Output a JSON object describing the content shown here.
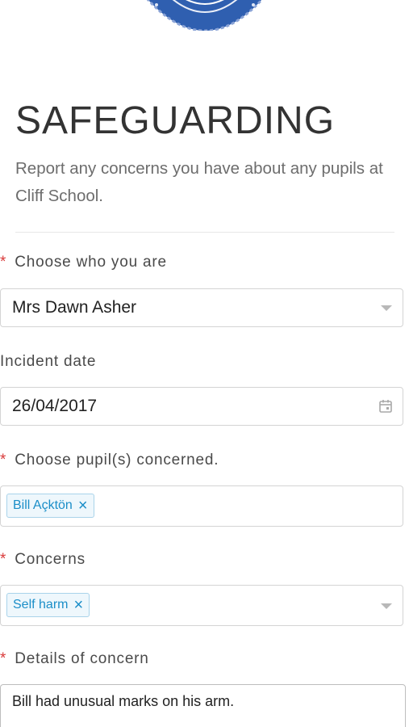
{
  "header": {
    "title": "SAFEGUARDING",
    "subtitle": "Report any concerns you have about any pupils at Cliff School."
  },
  "form": {
    "required_marker": "*",
    "who": {
      "label": "Choose who you are",
      "value": "Mrs Dawn Asher"
    },
    "incident_date": {
      "label": "Incident date",
      "value": "26/04/2017"
    },
    "pupils": {
      "label": "Choose pupil(s) concerned.",
      "tags": [
        "Bill Açktön"
      ]
    },
    "concerns": {
      "label": "Concerns",
      "tags": [
        "Self harm"
      ]
    },
    "details": {
      "label": "Details of concern",
      "value": "Bill had unusual marks on his arm."
    },
    "remove_glyph": "×"
  },
  "colors": {
    "required": "#d93a3a",
    "tag_text": "#1b8ec8",
    "tag_border": "#a9d3ea",
    "tag_bg": "#eef7fc",
    "logo_blue": "#2f5fb0"
  },
  "icons": {
    "logo": "school-badge-icon",
    "dropdown": "chevron-down-icon",
    "date": "calendar-icon",
    "remove": "close-icon"
  }
}
